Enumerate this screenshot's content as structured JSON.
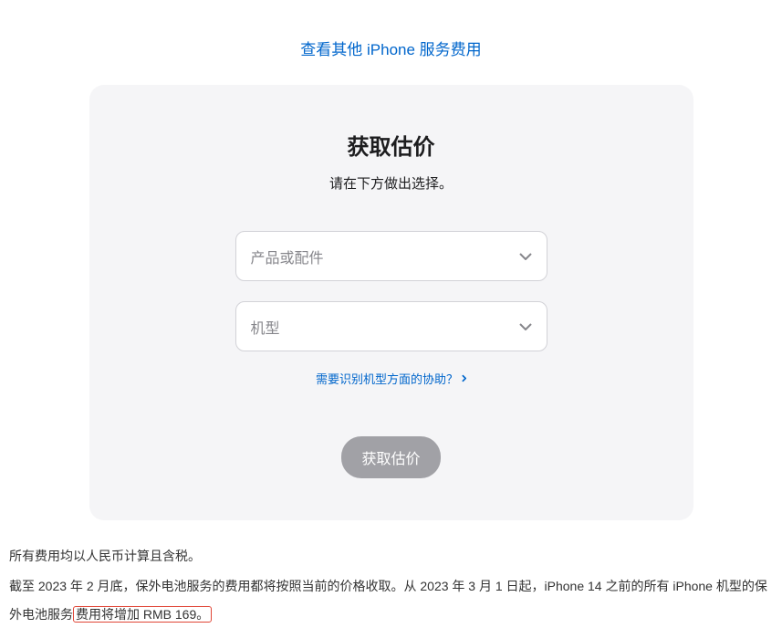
{
  "topLink": "查看其他 iPhone 服务费用",
  "card": {
    "title": "获取估价",
    "subtitle": "请在下方做出选择。",
    "select1Placeholder": "产品或配件",
    "select2Placeholder": "机型",
    "helpLink": "需要识别机型方面的协助？",
    "buttonLabel": "获取估价"
  },
  "footer": {
    "line1": "所有费用均以人民币计算且含税。",
    "line2_part1": "截至 2023 年 2 月底，保外电池服务的费用都将按照当前的价格收取。从 2023 年 3 月 1 日起，iPhone 14 之前的所有 iPhone 机型的保外电池服务",
    "line2_highlight": "费用将增加 RMB 169。"
  }
}
